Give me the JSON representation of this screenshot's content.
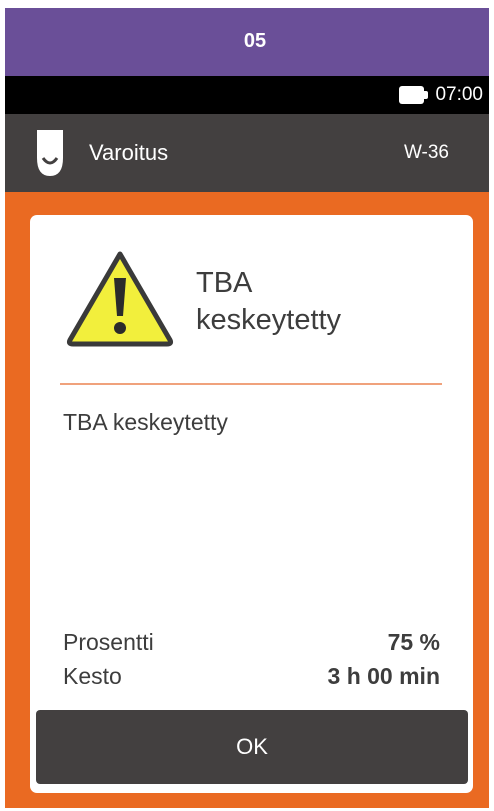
{
  "top_bar": {
    "label": "05",
    "color": "#6a4f98"
  },
  "status_bar": {
    "time": "07:00",
    "battery_icon": "battery-full-icon"
  },
  "header": {
    "icon": "device-icon",
    "title": "Varoitus",
    "code": "W-36"
  },
  "dialog": {
    "icon": "warning-triangle-icon",
    "title_line1": "TBA",
    "title_line2": "keskeytetty",
    "message": "TBA keskeytetty",
    "details": [
      {
        "label": "Prosentti",
        "value": "75 %"
      },
      {
        "label": "Kesto",
        "value": "3 h 00 min"
      }
    ],
    "ok_label": "OK"
  },
  "colors": {
    "accent_orange": "#ea6a22",
    "header_gray": "#434040",
    "warning_yellow": "#f2ef3c"
  }
}
